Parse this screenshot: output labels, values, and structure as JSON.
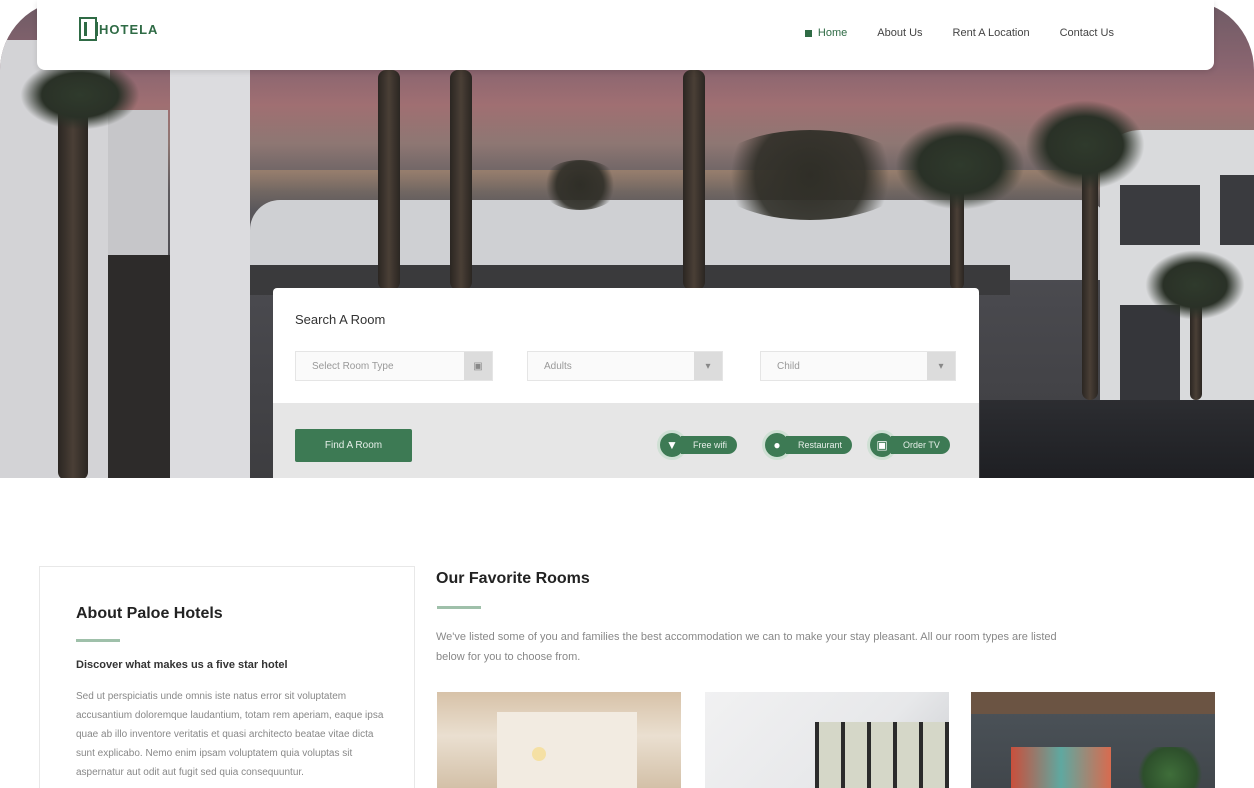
{
  "brand": {
    "logo_text": "HOTELA",
    "accent": "#2f6b45"
  },
  "nav": {
    "items": [
      {
        "label": "Home",
        "active": true
      },
      {
        "label": "About Us",
        "active": false
      },
      {
        "label": "Rent A Location",
        "active": false
      },
      {
        "label": "Contact Us",
        "active": false
      }
    ]
  },
  "search": {
    "title": "Search A Room",
    "fields": [
      {
        "value": "Select Room Type",
        "icon": "calendar-icon"
      },
      {
        "value": "Adults",
        "icon": "chevron-down-icon"
      },
      {
        "value": "Child",
        "icon": "chevron-down-icon"
      }
    ],
    "find_button": "Find A Room",
    "actions": [
      {
        "label": "Free wifi",
        "icon": "wifi-icon"
      },
      {
        "label": "Restaurant",
        "icon": "restaurant-icon"
      },
      {
        "label": "Order TV",
        "icon": "tv-icon"
      }
    ]
  },
  "about": {
    "title": "About Paloe Hotels",
    "subtitle": "Discover what makes us a five star hotel",
    "body": "Sed ut perspiciatis unde omnis iste natus error sit voluptatem accusantium doloremque laudantium, totam rem aperiam, eaque ipsa quae ab illo inventore veritatis et quasi architecto beatae vitae dicta sunt explicabo. Nemo enim ipsam voluptatem quia voluptas sit aspernatur aut odit aut fugit sed quia consequuntur."
  },
  "rooms": {
    "title": "Our Favorite Rooms",
    "description": "We've listed some of you and families the best accommodation we can to make your stay pleasant. All our room types are listed below for you to choose from."
  }
}
